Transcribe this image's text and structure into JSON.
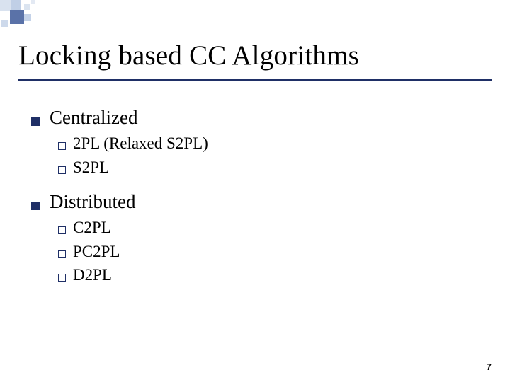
{
  "slide": {
    "title": "Locking based CC Algorithms",
    "sections": [
      {
        "label": "Centralized",
        "items": [
          {
            "text": "2PL (Relaxed S2PL)"
          },
          {
            "text": "S2PL"
          }
        ]
      },
      {
        "label": "Distributed",
        "items": [
          {
            "text": "C2PL"
          },
          {
            "text": "PC2PL"
          },
          {
            "text": "D2PL"
          }
        ]
      }
    ],
    "page_number": "7"
  }
}
